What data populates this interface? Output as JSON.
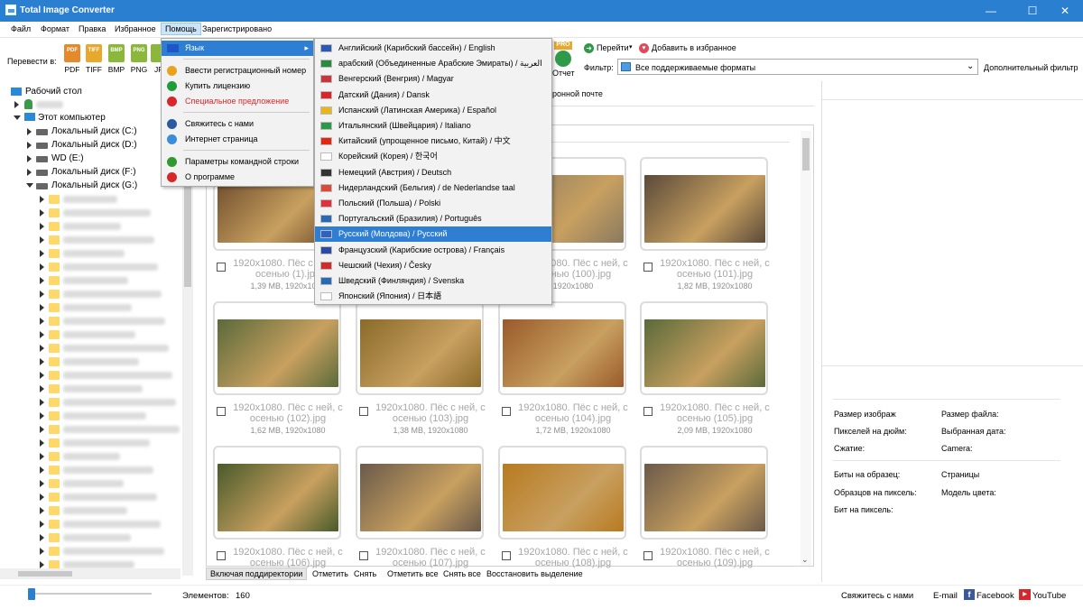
{
  "window": {
    "title": "Total Image Converter",
    "minimize": "—",
    "maximize": "☐",
    "close": "✕"
  },
  "menu": {
    "items": [
      "Файл",
      "Формат",
      "Правка",
      "Избранное",
      "Помощь",
      "Зарегистрировано"
    ]
  },
  "toolbar": {
    "convert_label": "Перевести в:",
    "formats": [
      "PDF",
      "TIFF",
      "BMP",
      "PNG",
      "JP"
    ],
    "report_label": "Отчет",
    "pro_badge": "PRO",
    "go_label": "Перейти",
    "add_fav_label": "Добавить в избранное",
    "filter_label": "Фильтр:",
    "filter_value": "Все поддерживаемые форматы",
    "adv_filter": "Дополнительный фильтр",
    "email_hint": "ронной почте"
  },
  "tree": {
    "desktop": "Рабочий стол",
    "this_pc": "Этот компьютер",
    "drives": [
      "Локальный диск (C:)",
      "Локальный диск (D:)",
      "WD (E:)",
      "Локальный диск (F:)",
      "Локальный диск (G:)"
    ]
  },
  "help_menu": {
    "items": [
      {
        "label": "Язык",
        "icon": "flag-icon",
        "color": "#1e56c8"
      },
      {
        "label": "Ввести регистрационный номер",
        "icon": "key-icon",
        "color": "#e8a31c"
      },
      {
        "label": "Купить лицензию",
        "icon": "dollar-icon",
        "color": "#1f9d3a"
      },
      {
        "label": "Специальное предложение",
        "icon": "info-icon",
        "color": "#d8262b",
        "red": true
      },
      {
        "label": "Свяжитесь с нами",
        "icon": "email-icon",
        "color": "#2c5aa0"
      },
      {
        "label": "Интернет страница",
        "icon": "globe-icon",
        "color": "#3b8dd8"
      },
      {
        "label": "Параметры командной строки",
        "icon": "cmd-icon",
        "color": "#2f9a2f"
      },
      {
        "label": "О программе",
        "icon": "info-icon",
        "color": "#d8262b"
      }
    ]
  },
  "languages": [
    {
      "label": "Английский (Карибский бассейн) / English",
      "flag": "#2a58b5"
    },
    {
      "label": "арабский (Объединенные Арабские Эмираты) / العربية",
      "flag": "#2a8a3e"
    },
    {
      "label": "Венгерский (Венгрия) / Magyar",
      "flag": "#c8363c"
    },
    {
      "label": "Датский (Дания) / Dansk",
      "flag": "#d8262b"
    },
    {
      "label": "Испанский (Латинская Америка) / Español",
      "flag": "#e8b51c"
    },
    {
      "label": "Итальянский (Швейцария) / Italiano",
      "flag": "#2a9a4a"
    },
    {
      "label": "Китайский (упрощенное письмо, Китай) / 中文",
      "flag": "#de2910"
    },
    {
      "label": "Корейский (Корея) / 한국어",
      "flag": "#ffffff"
    },
    {
      "label": "Немецкий (Австрия) / Deutsch",
      "flag": "#333333"
    },
    {
      "label": "Нидерландский (Бельгия) / de Nederlandse taal",
      "flag": "#d84a3a"
    },
    {
      "label": "Польский (Польша) / Polski",
      "flag": "#e03040"
    },
    {
      "label": "Португальский (Бразилия) / Português",
      "flag": "#2a6ab5"
    },
    {
      "label": "Русский (Молдова) / Русский",
      "flag": "#3060c0",
      "selected": true
    },
    {
      "label": "Французский (Карибские острова) / Français",
      "flag": "#2a4aa5"
    },
    {
      "label": "Чешский (Чехия) / Česky",
      "flag": "#d02c2c"
    },
    {
      "label": "Шведский (Финляндия) / Svenska",
      "flag": "#2a6ab5"
    },
    {
      "label": "Японский (Япония) / 日本語",
      "flag": "#ffffff"
    }
  ],
  "files": [
    {
      "name_line1": "1920x1080. Пёс с ней, с",
      "name_line2": "осенью (1).jpg",
      "info": "1,39 МВ, 1920x1080",
      "color": "#6b4a2a"
    },
    {
      "name_line1": "",
      "name_line2": "",
      "info": "",
      "color": "#7a6a4a"
    },
    {
      "name_line1": "1920x1080. Пёс с ней, с",
      "name_line2": "осенью (100).jpg",
      "info": "1920x1080",
      "color": "#8a7a60"
    },
    {
      "name_line1": "1920x1080. Пёс с ней, с",
      "name_line2": "осенью (101).jpg",
      "info": "1,82 МВ, 1920x1080",
      "color": "#5a4a3a"
    },
    {
      "name_line1": "1920x1080. Пёс с ней, с",
      "name_line2": "осенью (102).jpg",
      "info": "1,62 МВ, 1920x1080",
      "color": "#5a6a3a"
    },
    {
      "name_line1": "1920x1080. Пёс с ней, с",
      "name_line2": "осенью (103).jpg",
      "info": "1,38 МВ, 1920x1080",
      "color": "#8a6a2a"
    },
    {
      "name_line1": "1920x1080. Пёс с ней, с",
      "name_line2": "осенью (104).jpg",
      "info": "1,72 МВ, 1920x1080",
      "color": "#9a5a2a"
    },
    {
      "name_line1": "1920x1080. Пёс с ней, с",
      "name_line2": "осенью (105).jpg",
      "info": "2,09 МВ, 1920x1080",
      "color": "#5a6a3a"
    },
    {
      "name_line1": "1920x1080. Пёс с ней, с",
      "name_line2": "осенью (106).jpg",
      "info": "",
      "color": "#4a5a2a"
    },
    {
      "name_line1": "1920x1080. Пёс с ней, с",
      "name_line2": "осенью (107).jpg",
      "info": "",
      "color": "#6a5a4a"
    },
    {
      "name_line1": "1920x1080. Пёс с ней, с",
      "name_line2": "осенью (108).jpg",
      "info": "",
      "color": "#b87a20"
    },
    {
      "name_line1": "1920x1080. Пёс с ней, с",
      "name_line2": "осенью (109).jpg",
      "info": "",
      "color": "#6a5a4a"
    }
  ],
  "bottom": {
    "include_sub": "Включая поддиректории",
    "check": "Отметить",
    "uncheck": "Снять",
    "check_all": "Отметить все",
    "uncheck_all": "Снять все",
    "restore": "Восстановить выделение"
  },
  "props": {
    "size": "Размер изображ",
    "file_size": "Размер файла:",
    "dpi": "Пикселей на дюйм:",
    "date": "Выбранная дата:",
    "compression": "Сжатие:",
    "camera": "Camera:",
    "bits_sample": "Биты на образец:",
    "pages": "Страницы",
    "samples_pixel": "Образцов на пиксель:",
    "color_model": "Модель цвета:",
    "bits_pixel": "Бит на пиксель:"
  },
  "status": {
    "elements_label": "Элементов:",
    "elements_count": "160",
    "contact": "Свяжитесь с нами",
    "email": "E-mail",
    "facebook": "Facebook",
    "youtube": "YouTube"
  }
}
